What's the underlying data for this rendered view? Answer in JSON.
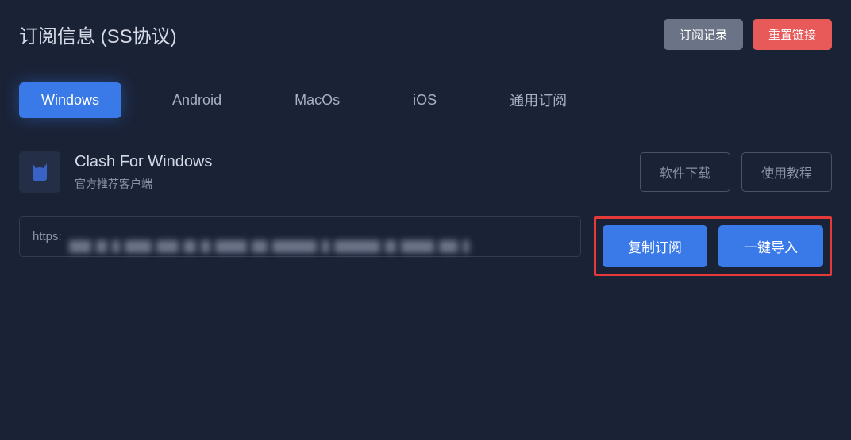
{
  "header": {
    "title": "订阅信息 (SS协议)",
    "history_button": "订阅记录",
    "reset_button": "重置链接"
  },
  "tabs": [
    {
      "label": "Windows",
      "active": true
    },
    {
      "label": "Android",
      "active": false
    },
    {
      "label": "MacOs",
      "active": false
    },
    {
      "label": "iOS",
      "active": false
    },
    {
      "label": "通用订阅",
      "active": false
    }
  ],
  "client": {
    "name": "Clash For Windows",
    "description": "官方推荐客户端",
    "download_button": "软件下载",
    "tutorial_button": "使用教程"
  },
  "subscription": {
    "url_prefix": "https:",
    "copy_button": "复制订阅",
    "import_button": "一键导入"
  }
}
